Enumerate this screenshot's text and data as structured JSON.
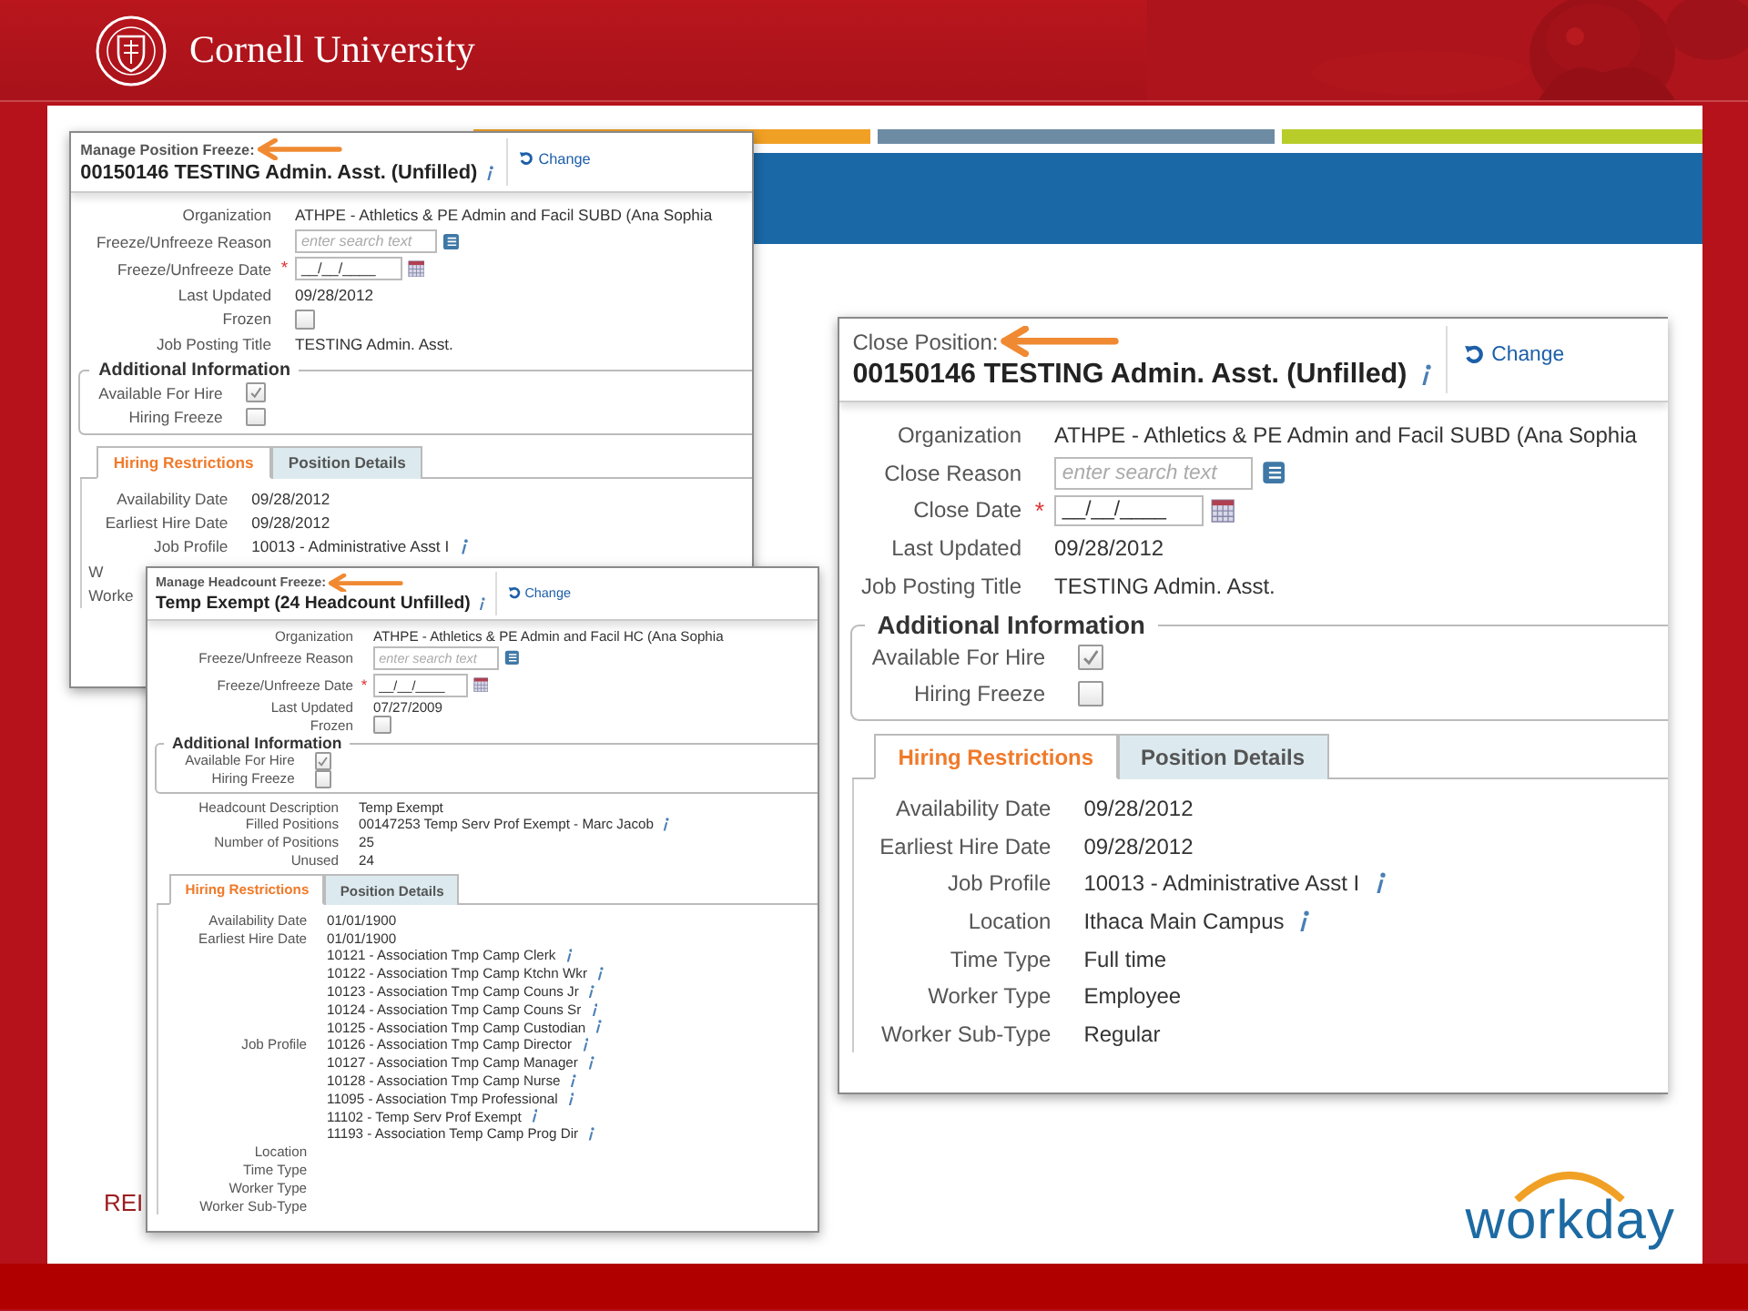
{
  "header": {
    "university": "Cornell University"
  },
  "panels": [
    {
      "caption": "Manage Position Freeze:",
      "title": "00150146 TESTING Admin. Asst. (Unfilled)",
      "info": true,
      "change": "Change",
      "fields": [
        {
          "kind": "text",
          "label": "Organization",
          "values": [
            {
              "text": "ATHPE - Athletics & PE Admin and Facil SUBD (Ana Sophia",
              "info": false
            }
          ]
        },
        {
          "kind": "search",
          "label": "Freeze/Unfreeze Reason",
          "placeholder": "enter search text"
        },
        {
          "kind": "date",
          "label": "Freeze/Unfreeze Date",
          "placeholder": "__/__/____",
          "required_mark": "*"
        },
        {
          "kind": "text",
          "label": "Last Updated",
          "values": [
            {
              "text": "09/28/2012",
              "info": false
            }
          ]
        },
        {
          "kind": "checkbox",
          "label": "Frozen",
          "checked": false
        },
        {
          "kind": "text",
          "label": "Job Posting Title",
          "values": [
            {
              "text": "TESTING Admin. Asst.",
              "info": false
            }
          ]
        }
      ],
      "additional": {
        "title": "Additional Information",
        "items": [
          {
            "label": "Available For Hire",
            "checked": true
          },
          {
            "label": "Hiring Freeze",
            "checked": false
          }
        ]
      },
      "tabs": [
        {
          "label": "Hiring Restrictions",
          "selected": true
        },
        {
          "label": "Position Details",
          "selected": false
        }
      ],
      "tab_fields": [
        {
          "kind": "text",
          "label": "Availability Date",
          "values": [
            {
              "text": "09/28/2012",
              "info": false
            }
          ]
        },
        {
          "kind": "text",
          "label": "Earliest Hire Date",
          "values": [
            {
              "text": "09/28/2012",
              "info": false
            }
          ]
        },
        {
          "kind": "text",
          "label": "Job Profile",
          "values": [
            {
              "text": "10013 - Administrative Asst I",
              "info": true
            }
          ]
        },
        {
          "kind": "cut",
          "label": "W"
        },
        {
          "kind": "cut",
          "label": "Worke"
        }
      ]
    },
    {
      "caption": "Manage Headcount Freeze:",
      "title": "Temp Exempt (24 Headcount Unfilled)",
      "info": true,
      "change": "Change",
      "fields": [
        {
          "kind": "text",
          "label": "Organization",
          "values": [
            {
              "text": "ATHPE - Athletics & PE Admin and Facil HC (Ana Sophia",
              "info": false
            }
          ]
        },
        {
          "kind": "search",
          "label": "Freeze/Unfreeze Reason",
          "placeholder": "enter search text"
        },
        {
          "kind": "date",
          "label": "Freeze/Unfreeze Date",
          "placeholder": "__/__/____",
          "required_mark": "*"
        },
        {
          "kind": "text",
          "label": "Last Updated",
          "values": [
            {
              "text": "07/27/2009",
              "info": false
            }
          ]
        },
        {
          "kind": "checkbox",
          "label": "Frozen",
          "checked": false
        }
      ],
      "additional": {
        "title": "Additional Information",
        "items": [
          {
            "label": "Available For Hire",
            "checked": true
          },
          {
            "label": "Hiring Freeze",
            "checked": false
          }
        ]
      },
      "details": [
        {
          "kind": "text",
          "label": "Headcount Description",
          "values": [
            {
              "text": "Temp Exempt",
              "info": false
            }
          ]
        },
        {
          "kind": "text",
          "label": "Filled Positions",
          "values": [
            {
              "text": "00147253 Temp Serv Prof Exempt - Marc Jacob",
              "info": true
            }
          ]
        },
        {
          "kind": "text",
          "label": "Number of Positions",
          "values": [
            {
              "text": "25",
              "info": false
            }
          ]
        },
        {
          "kind": "text",
          "label": "Unused",
          "values": [
            {
              "text": "24",
              "info": false
            }
          ]
        }
      ],
      "tabs": [
        {
          "label": "Hiring Restrictions",
          "selected": true
        },
        {
          "label": "Position Details",
          "selected": false
        }
      ],
      "tab_fields": [
        {
          "kind": "text",
          "label": "Availability Date",
          "values": [
            {
              "text": "01/01/1900",
              "info": false
            }
          ]
        },
        {
          "kind": "text",
          "label": "Earliest Hire Date",
          "values": [
            {
              "text": "01/01/1900",
              "info": false
            }
          ]
        },
        {
          "kind": "text",
          "label": "Job Profile",
          "values": [
            {
              "text": "10121 - Association Tmp Camp Clerk",
              "info": true
            },
            {
              "text": "10122 - Association Tmp Camp Ktchn Wkr",
              "info": true
            },
            {
              "text": "10123 - Association Tmp Camp Couns Jr",
              "info": true
            },
            {
              "text": "10124 - Association Tmp Camp Couns Sr",
              "info": true
            },
            {
              "text": "10125 - Association Tmp Camp Custodian",
              "info": true
            },
            {
              "text": "10126 - Association Tmp Camp Director",
              "info": true
            },
            {
              "text": "10127 - Association Tmp Camp Manager",
              "info": true
            },
            {
              "text": "10128 - Association Tmp Camp Nurse",
              "info": true
            },
            {
              "text": "11095 - Association Tmp Professional",
              "info": true
            },
            {
              "text": "11102 - Temp Serv Prof Exempt",
              "info": true
            },
            {
              "text": "11193 - Association Temp Camp Prog Dir",
              "info": true
            }
          ]
        },
        {
          "kind": "text",
          "label": "Location"
        },
        {
          "kind": "text",
          "label": "Time Type"
        },
        {
          "kind": "text",
          "label": "Worker Type"
        },
        {
          "kind": "text",
          "label": "Worker Sub-Type"
        }
      ]
    },
    {
      "caption": "Close Position:",
      "title": "00150146 TESTING Admin. Asst. (Unfilled)",
      "info": true,
      "change": "Change",
      "fields": [
        {
          "kind": "text",
          "label": "Organization",
          "values": [
            {
              "text": "ATHPE - Athletics & PE Admin and Facil SUBD (Ana Sophia",
              "info": false
            }
          ]
        },
        {
          "kind": "search",
          "label": "Close Reason",
          "placeholder": "enter search text"
        },
        {
          "kind": "date",
          "label": "Close Date",
          "placeholder": "__/__/____",
          "required_mark": "*"
        },
        {
          "kind": "text",
          "label": "Last Updated",
          "values": [
            {
              "text": "09/28/2012",
              "info": false
            }
          ]
        },
        {
          "kind": "text",
          "label": "Job Posting Title",
          "values": [
            {
              "text": "TESTING Admin. Asst.",
              "info": false
            }
          ]
        }
      ],
      "additional": {
        "title": "Additional Information",
        "items": [
          {
            "label": "Available For Hire",
            "checked": true
          },
          {
            "label": "Hiring Freeze",
            "checked": false
          }
        ]
      },
      "tabs": [
        {
          "label": "Hiring Restrictions",
          "selected": true
        },
        {
          "label": "Position Details",
          "selected": false
        }
      ],
      "tab_fields": [
        {
          "kind": "text",
          "label": "Availability Date",
          "values": [
            {
              "text": "09/28/2012",
              "info": false
            }
          ]
        },
        {
          "kind": "text",
          "label": "Earliest Hire Date",
          "values": [
            {
              "text": "09/28/2012",
              "info": false
            }
          ]
        },
        {
          "kind": "text",
          "label": "Job Profile",
          "values": [
            {
              "text": "10013 - Administrative Asst I",
              "info": true
            }
          ]
        },
        {
          "kind": "text",
          "label": "Location",
          "values": [
            {
              "text": "Ithaca Main Campus",
              "info": true
            }
          ]
        },
        {
          "kind": "text",
          "label": "Time Type",
          "values": [
            {
              "text": "Full time",
              "info": false
            }
          ]
        },
        {
          "kind": "text",
          "label": "Worker Type",
          "values": [
            {
              "text": "Employee",
              "info": false
            }
          ]
        },
        {
          "kind": "text",
          "label": "Worker Sub-Type",
          "values": [
            {
              "text": "Regular",
              "info": false
            }
          ]
        }
      ]
    }
  ],
  "footer_text": "REI",
  "logo": {
    "text": "workday"
  }
}
